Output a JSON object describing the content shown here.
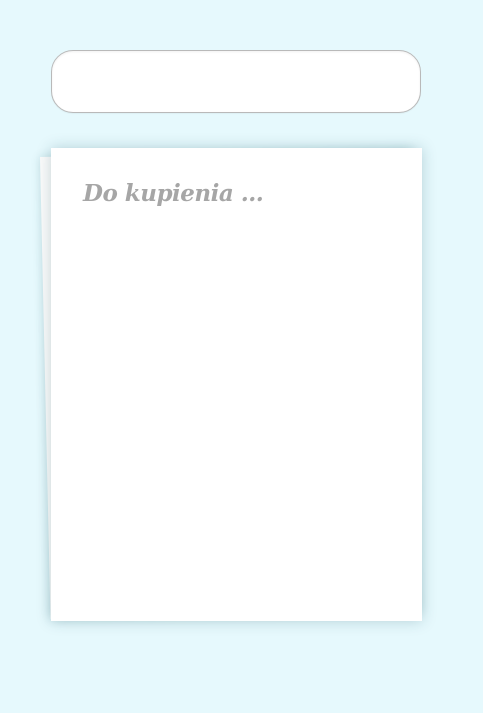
{
  "new_item": {
    "value": "",
    "placeholder": ""
  },
  "list": {
    "title": "Do kupienia ...",
    "items": []
  }
}
